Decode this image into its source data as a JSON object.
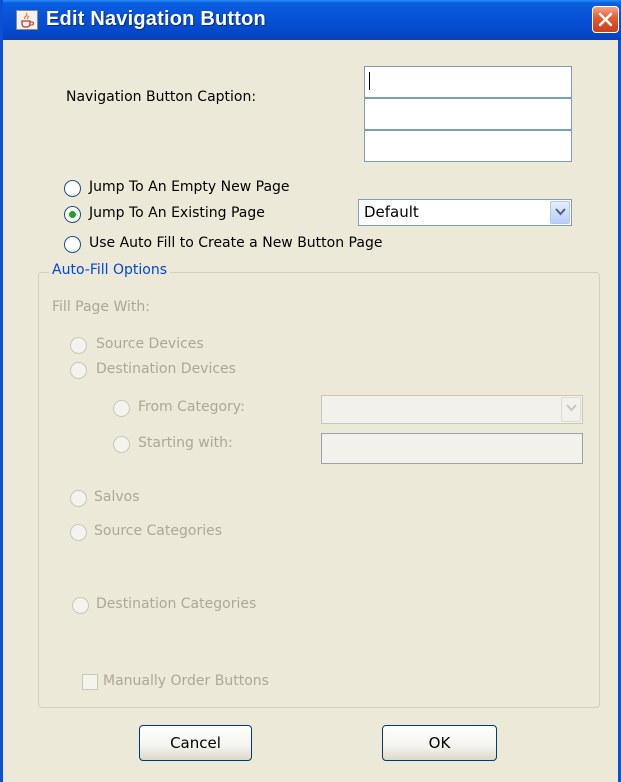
{
  "window": {
    "title": "Edit Navigation Button",
    "app_icon": "java-cup-icon",
    "close_icon": "close-icon"
  },
  "caption": {
    "label": "Navigation Button Caption:",
    "lines": [
      "",
      "",
      ""
    ]
  },
  "options": {
    "empty_page": "Jump To An Empty New Page",
    "existing_page": "Jump To An Existing Page",
    "auto_fill": "Use Auto Fill to Create a New Button Page",
    "selected": "existing_page",
    "existing_page_value": "Default"
  },
  "auto_fill": {
    "title": "Auto-Fill Options",
    "fill_with_label": "Fill Page With:",
    "source_devices": "Source Devices",
    "destination_devices": "Destination Devices",
    "from_category": "From Category:",
    "from_category_value": "",
    "starting_with": "Starting with:",
    "starting_with_value": "",
    "salvos": "Salvos",
    "source_categories": "Source Categories",
    "destination_categories": "Destination Categories",
    "manually_order": "Manually Order Buttons",
    "manually_order_checked": false,
    "enabled": false
  },
  "buttons": {
    "cancel": "Cancel",
    "ok": "OK"
  },
  "colors": {
    "titlebar": "#0653d8",
    "group_title": "#0046d5",
    "disabled_text": "#aca899",
    "selected_radio": "#21a121"
  }
}
